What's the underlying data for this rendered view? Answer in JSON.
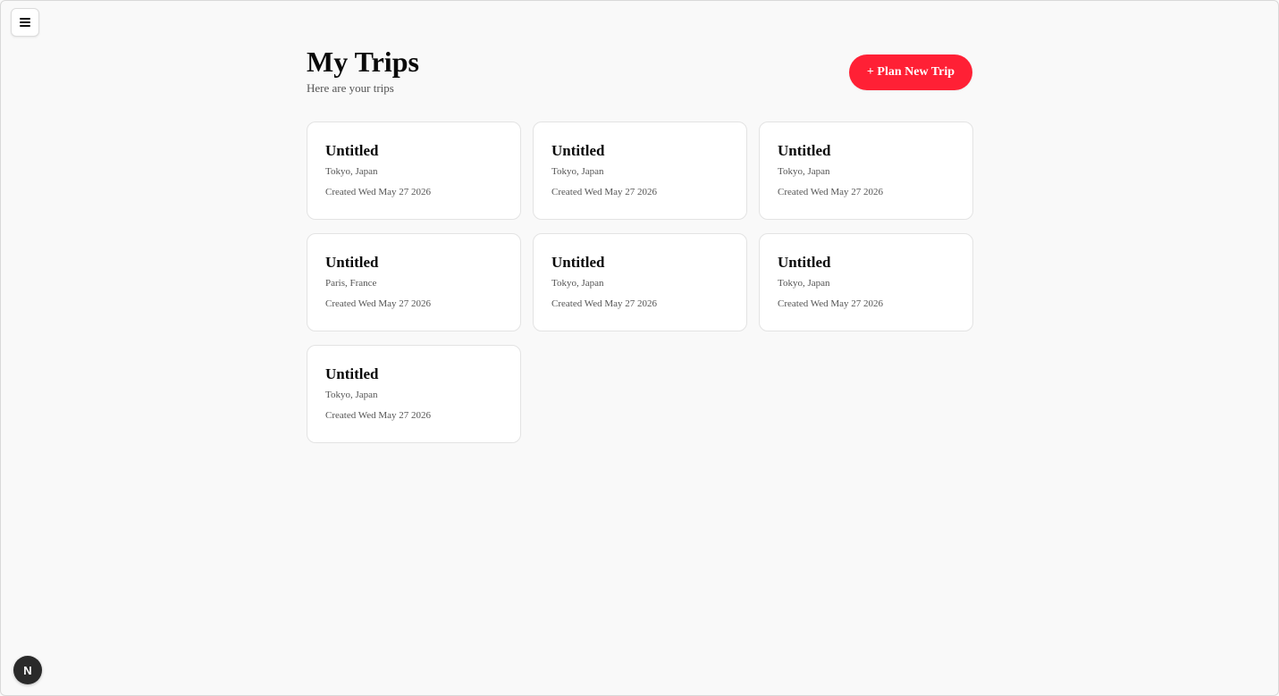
{
  "app": {
    "menu_icon": "hamburger-icon",
    "dev_badge_label": "N",
    "dev_badge_icon": "nextjs-icon"
  },
  "header": {
    "title": "My Trips",
    "subtitle": "Here are your trips",
    "plan_button_label": "+ Plan New Trip"
  },
  "colors": {
    "accent": "#ff2035",
    "background": "#f9f9f9",
    "card_bg": "#ffffff",
    "card_border": "#e3e3e3"
  },
  "trips": [
    {
      "title": "Untitled",
      "location": "Tokyo, Japan",
      "created": "Created Wed May 27 2026"
    },
    {
      "title": "Untitled",
      "location": "Tokyo, Japan",
      "created": "Created Wed May 27 2026"
    },
    {
      "title": "Untitled",
      "location": "Tokyo, Japan",
      "created": "Created Wed May 27 2026"
    },
    {
      "title": "Untitled",
      "location": "Paris, France",
      "created": "Created Wed May 27 2026"
    },
    {
      "title": "Untitled",
      "location": "Tokyo, Japan",
      "created": "Created Wed May 27 2026"
    },
    {
      "title": "Untitled",
      "location": "Tokyo, Japan",
      "created": "Created Wed May 27 2026"
    },
    {
      "title": "Untitled",
      "location": "Tokyo, Japan",
      "created": "Created Wed May 27 2026"
    }
  ]
}
